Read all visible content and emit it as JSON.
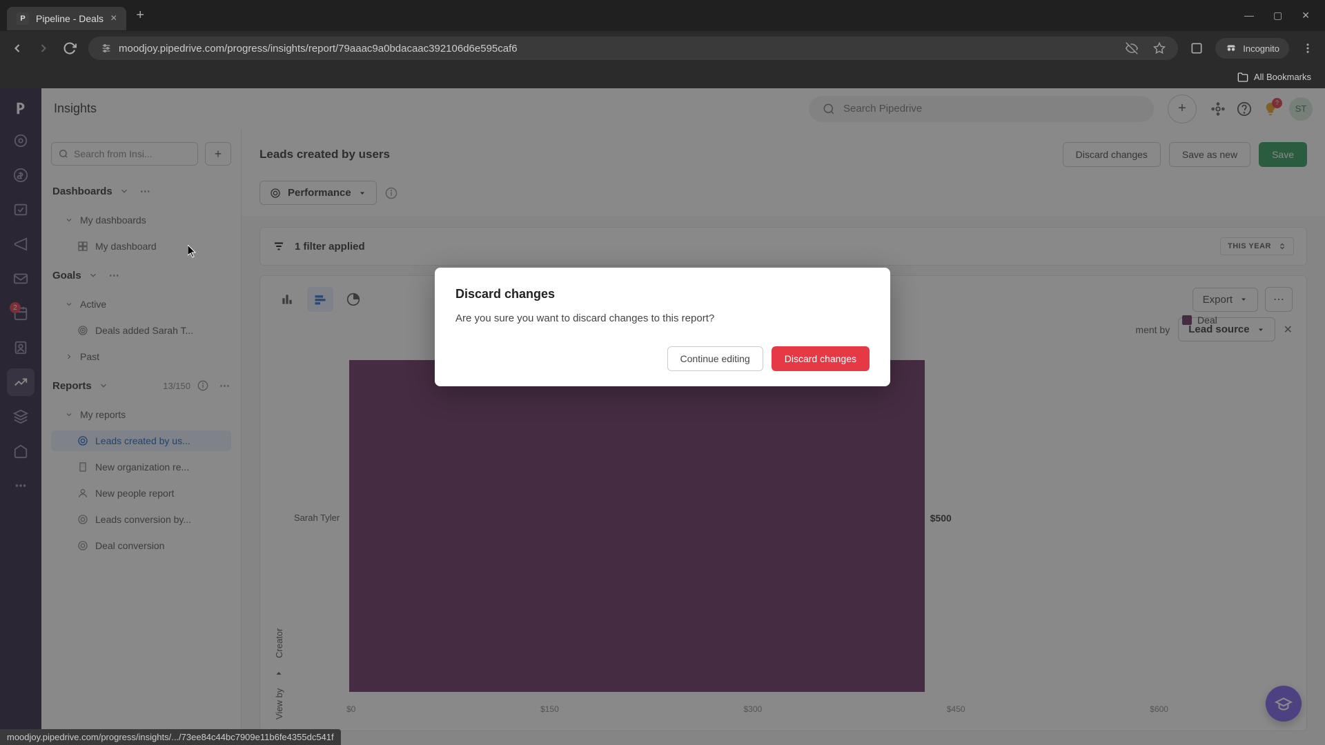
{
  "browser": {
    "tab_title": "Pipeline - Deals",
    "tab_favicon": "P",
    "url": "moodjoy.pipedrive.com/progress/insights/report/79aaac9a0bdacaac392106d6e595caf6",
    "bookmarks_label": "All Bookmarks",
    "incognito": "Incognito",
    "status_link": "moodjoy.pipedrive.com/progress/insights/.../73ee84c44bc7909e11b6fe4355dc541f"
  },
  "rail_badge_activities": "2",
  "header": {
    "title": "Insights",
    "search_placeholder": "Search Pipedrive",
    "tip_badge": "?",
    "avatar": "ST"
  },
  "left_panel": {
    "search_placeholder": "Search from Insi...",
    "sections": {
      "dashboards": "Dashboards",
      "goals": "Goals",
      "reports": "Reports",
      "reports_count": "13/150"
    },
    "dashboards": {
      "my_dashboards": "My dashboards",
      "items": [
        {
          "label": "My dashboard"
        }
      ]
    },
    "goals": {
      "active": "Active",
      "items": [
        {
          "label": "Deals added Sarah T..."
        }
      ],
      "past": "Past"
    },
    "reports": {
      "my_reports": "My reports",
      "items": [
        {
          "label": "Leads created by us..."
        },
        {
          "label": "New organization re..."
        },
        {
          "label": "New people report"
        },
        {
          "label": "Leads conversion by..."
        },
        {
          "label": "Deal conversion"
        }
      ]
    }
  },
  "report": {
    "title": "Leads created by users",
    "discard": "Discard changes",
    "save_new": "Save as new",
    "save": "Save",
    "performance": "Performance",
    "filter_applied": "1 filter applied",
    "time_range": "THIS YEAR",
    "export": "Export",
    "segment_label": "ment by",
    "segment_value": "Lead source",
    "legend": "Deal",
    "y_label_1": "Creator",
    "y_label_2": "View by"
  },
  "chart_data": {
    "type": "bar",
    "orientation": "horizontal",
    "categories": [
      "Sarah Tyler"
    ],
    "values": [
      500
    ],
    "xlabel": "",
    "ylabel": "Creator",
    "xlim": [
      0,
      600
    ],
    "x_ticks": [
      "$0",
      "$150",
      "$300",
      "$450",
      "$600"
    ],
    "value_labels": [
      "$500"
    ],
    "series_name": "Deal"
  },
  "modal": {
    "title": "Discard changes",
    "body": "Are you sure you want to discard changes to this report?",
    "cancel": "Continue editing",
    "confirm": "Discard changes"
  }
}
